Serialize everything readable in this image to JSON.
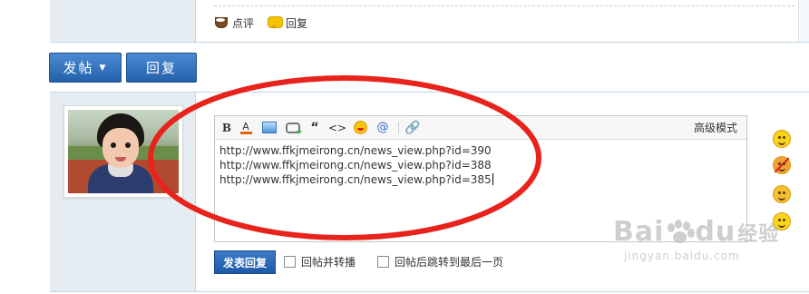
{
  "actions": {
    "comment": "点评",
    "reply": "回复"
  },
  "buttons": {
    "new_post": "发帖",
    "reply": "回复"
  },
  "editor": {
    "toolbar": {
      "bold": "B",
      "font_color": "A",
      "quote": "“",
      "code": "<>",
      "at": "@",
      "advanced": "高级模式"
    },
    "lines": [
      "http://www.ffkjmeirong.cn/news_view.php?id=390",
      "http://www.ffkjmeirong.cn/news_view.php?id=388",
      "http://www.ffkjmeirong.cn/news_view.php?id=385"
    ]
  },
  "submit": {
    "label": "发表回复"
  },
  "options": {
    "forward": "回帖并转播",
    "jump_last": "回帖后跳转到最后一页"
  },
  "watermark": {
    "brand_left": "Bai",
    "brand_right": "du",
    "brand_cn": "经验",
    "url": "jingyan.baidu.com"
  },
  "colors": {
    "button_blue": "#2c6ab8",
    "annotation_red": "#e8231c",
    "sidebar_bg": "#e5edf2"
  },
  "icons": [
    "cup-icon",
    "speech-bubble-icon",
    "dropdown-caret-icon",
    "image-icon",
    "link-icon",
    "smiley-icon",
    "attachment-icon"
  ]
}
